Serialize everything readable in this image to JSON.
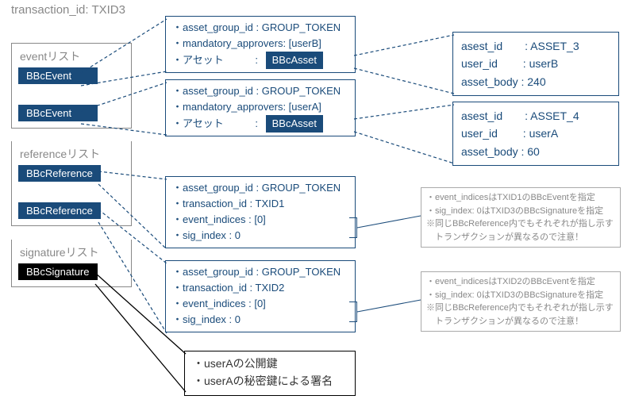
{
  "transaction_id_label": "transaction_id: TXID3",
  "lists": {
    "event": {
      "title": "eventリスト",
      "items": [
        "BBcEvent",
        "BBcEvent"
      ]
    },
    "reference": {
      "title": "referenceリスト",
      "items": [
        "BBcReference",
        "BBcReference"
      ]
    },
    "signature": {
      "title": "signatureリスト",
      "items": [
        "BBcSignature"
      ]
    }
  },
  "event_details": [
    {
      "l1": "・asset_group_id : GROUP_TOKEN",
      "l2": "・mandatory_approvers: [userB]",
      "l3_label": "・アセット",
      "l3_sep": ":",
      "l3_tag": "BBcAsset"
    },
    {
      "l1": "・asset_group_id : GROUP_TOKEN",
      "l2": "・mandatory_approvers: [userA]",
      "l3_label": "・アセット",
      "l3_sep": ":",
      "l3_tag": "BBcAsset"
    }
  ],
  "assets": [
    {
      "l1": "asest_id　　: ASSET_3",
      "l2": "user_id　　 : userB",
      "l3": "asset_body : 240"
    },
    {
      "l1": "asest_id　　: ASSET_4",
      "l2": "user_id　　 : userA",
      "l3": "asset_body : 60"
    }
  ],
  "reference_details": [
    {
      "l1": "・asset_group_id : GROUP_TOKEN",
      "l2": "・transaction_id  : TXID1",
      "l3": "・event_indices   : [0]",
      "l4": "・sig_index          : 0"
    },
    {
      "l1": "・asset_group_id : GROUP_TOKEN",
      "l2": "・transaction_id  : TXID2",
      "l3": "・event_indices   : [0]",
      "l4": "・sig_index          : 0"
    }
  ],
  "notes": [
    {
      "l1": "・event_indicesはTXID1のBBcEventを指定",
      "l2": "・sig_index: 0はTXID3のBBcSignatureを指定",
      "l3": "※同じBBcReference内でもそれぞれが指し示す",
      "l4": "　トランザクションが異なるので注意！"
    },
    {
      "l1": "・event_indicesはTXID2のBBcEventを指定",
      "l2": "・sig_index: 0はTXID3のBBcSignatureを指定",
      "l3": "※同じBBcReference内でもそれぞれが指し示す",
      "l4": "　トランザクションが異なるので注意！"
    }
  ],
  "signature_detail": {
    "l1": "・userAの公開鍵",
    "l2": "・userAの秘密鍵による署名"
  }
}
